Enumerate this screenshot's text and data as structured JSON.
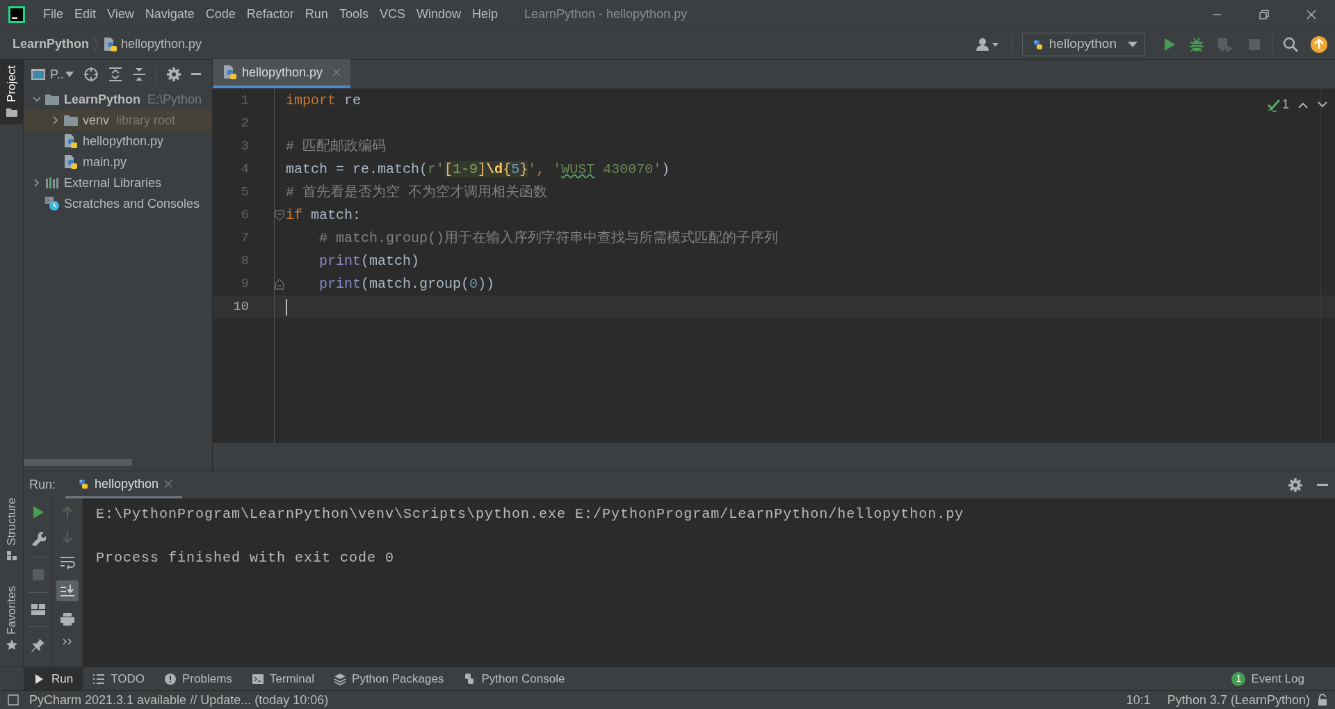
{
  "title_bar": {
    "menu": [
      "File",
      "Edit",
      "View",
      "Navigate",
      "Code",
      "Refactor",
      "Run",
      "Tools",
      "VCS",
      "Window",
      "Help"
    ],
    "title": "LearnPython - hellopython.py"
  },
  "navigation_bar": {
    "breadcrumbs": [
      "LearnPython",
      "hellopython.py"
    ],
    "run_configuration": "hellopython"
  },
  "left_stripe": {
    "top": [
      {
        "label": "Project",
        "selected": true
      }
    ],
    "bottom": [
      {
        "label": "Structure",
        "selected": false
      },
      {
        "label": "Favorites",
        "selected": false
      }
    ]
  },
  "project_panel": {
    "view_label": "P..",
    "tree": [
      {
        "label": "LearnPython",
        "hint": "E:\\Python",
        "kind": "module",
        "expanded": true,
        "children": [
          {
            "label": "venv",
            "hint": "library root",
            "kind": "library_folder",
            "expanded": false
          },
          {
            "label": "hellopython.py",
            "kind": "python_file"
          },
          {
            "label": "main.py",
            "kind": "python_file"
          }
        ]
      },
      {
        "label": "External Libraries",
        "kind": "libraries",
        "expanded": false
      },
      {
        "label": "Scratches and Consoles",
        "kind": "scratches"
      }
    ]
  },
  "editor": {
    "tabs": [
      {
        "label": "hellopython.py",
        "selected": true
      }
    ],
    "inspection_count": "1",
    "lines": [
      {
        "number": "1",
        "current": false,
        "tokens": [
          {
            "text": "import",
            "kind": "keyword"
          },
          {
            "text": " re",
            "kind": "plain"
          }
        ]
      },
      {
        "number": "2",
        "current": false
      },
      {
        "number": "3",
        "current": false,
        "tokens": [
          {
            "text": "# 匹配邮政编码",
            "kind": "comment"
          }
        ]
      },
      {
        "number": "4",
        "current": false,
        "tokens": [
          {
            "text": "match = re.match(",
            "kind": "plain"
          },
          {
            "text": "r'",
            "kind": "string"
          },
          {
            "text": "[",
            "kind": "regex_bracket"
          },
          {
            "text": "1-9",
            "kind": "regex_text"
          },
          {
            "text": "]",
            "kind": "regex_bracket"
          },
          {
            "text": "\\d",
            "kind": "regex_escape"
          },
          {
            "text": "{",
            "kind": "regex_bracket"
          },
          {
            "text": "5",
            "kind": "regex_number"
          },
          {
            "text": "}",
            "kind": "regex_bracket"
          },
          {
            "text": "'",
            "kind": "string"
          },
          {
            "text": ", ",
            "kind": "keyword"
          },
          {
            "text": "'",
            "kind": "string"
          },
          {
            "text": "WUST",
            "kind": "typo"
          },
          {
            "text": " 430070'",
            "kind": "string"
          },
          {
            "text": ")",
            "kind": "plain"
          }
        ]
      },
      {
        "number": "5",
        "current": false,
        "tokens": [
          {
            "text": "# 首先看是否为空 不为空才调用相关函数",
            "kind": "comment"
          }
        ]
      },
      {
        "number": "6",
        "current": false,
        "kind": "fold_start",
        "tokens": [
          {
            "text": "if",
            "kind": "keyword"
          },
          {
            "text": " match:",
            "kind": "plain"
          }
        ]
      },
      {
        "number": "7",
        "current": false,
        "tokens": [
          {
            "text": "    # match.group()用于在输入序列字符串中查找与所需模式匹配的子序列",
            "kind": "comment"
          }
        ]
      },
      {
        "number": "8",
        "current": false,
        "tokens": [
          {
            "text": "    print",
            "kind": "builtin"
          },
          {
            "text": "(match)",
            "kind": "plain"
          }
        ]
      },
      {
        "number": "9",
        "current": false,
        "kind": "fold_end",
        "tokens": [
          {
            "text": "    print",
            "kind": "builtin"
          },
          {
            "text": "(match.group(",
            "kind": "plain"
          },
          {
            "text": "0",
            "kind": "number"
          },
          {
            "text": "))",
            "kind": "plain"
          }
        ]
      },
      {
        "number": "10",
        "current": true
      }
    ]
  },
  "run_panel": {
    "label": "Run:",
    "tabs": [
      {
        "label": "hellopython",
        "selected": true
      }
    ],
    "output": [
      "E:\\PythonProgram\\LearnPython\\venv\\Scripts\\python.exe E:/PythonProgram/LearnPython/hellopython.py",
      "Process finished with exit code 0"
    ]
  },
  "tool_strip": [
    {
      "label": "Run",
      "kind": "run",
      "selected": true
    },
    {
      "label": "TODO",
      "kind": "todo",
      "selected": false
    },
    {
      "label": "Problems",
      "kind": "problems",
      "selected": false
    },
    {
      "label": "Terminal",
      "kind": "terminal",
      "selected": false
    },
    {
      "label": "Python Packages",
      "kind": "packages",
      "selected": false
    },
    {
      "label": "Python Console",
      "kind": "console",
      "selected": false
    }
  ],
  "event_log": {
    "label": "Event Log",
    "count": "1"
  },
  "status_bar": {
    "message": "PyCharm 2021.3.1 available // Update... (today 10:06)",
    "position": "10:1",
    "interpreter": "Python 3.7 (LearnPython)"
  }
}
